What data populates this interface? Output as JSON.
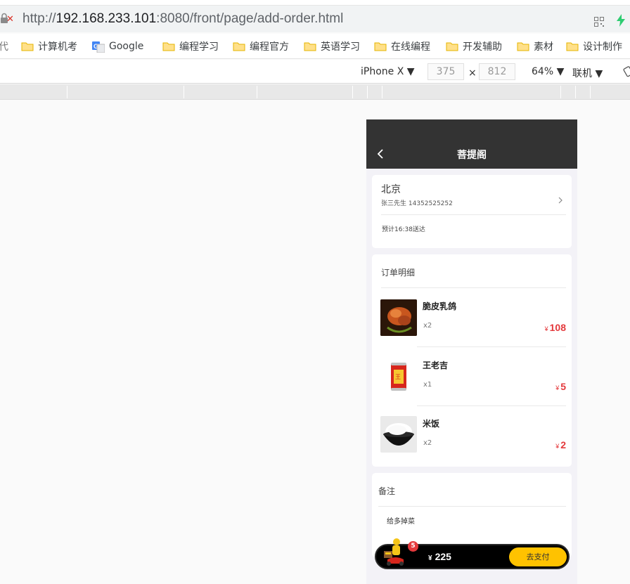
{
  "browser": {
    "url_scheme": "http://",
    "url_host": "192.168.233.101",
    "url_rest": ":8080/front/page/add-order.html",
    "bookmarks": [
      {
        "label": "代",
        "faded": true
      },
      {
        "label": "计算机考",
        "faded": false
      },
      {
        "label": "Google",
        "faded": false
      },
      {
        "label": "编程学习",
        "faded": false
      },
      {
        "label": "编程官方",
        "faded": false
      },
      {
        "label": "英语学习",
        "faded": false
      },
      {
        "label": "在线编程",
        "faded": false
      },
      {
        "label": "开发辅助",
        "faded": false
      },
      {
        "label": "素材",
        "faded": false
      },
      {
        "label": "设计制作",
        "faded": false
      }
    ]
  },
  "devtools": {
    "device": "iPhone X",
    "width": "375",
    "times": "×",
    "height": "812",
    "zoom": "64%",
    "network": "联机"
  },
  "app": {
    "shop_name": "菩提阁",
    "address": {
      "city": "北京",
      "contact": "张三先生 14352525252",
      "eta": "预计16:38送达"
    },
    "order": {
      "title": "订单明细",
      "items": [
        {
          "name": "脆皮乳鸽",
          "qty": "x2",
          "price": "108"
        },
        {
          "name": "王老吉",
          "qty": "x1",
          "price": "5"
        },
        {
          "name": "米饭",
          "qty": "x2",
          "price": "2"
        }
      ],
      "currency": "¥"
    },
    "note": {
      "title": "备注",
      "text": "给多掉菜"
    },
    "checkout": {
      "badge": "5",
      "currency": "¥",
      "total": "225",
      "pay_label": "去支付"
    }
  },
  "colors": {
    "header_bg": "#333333",
    "price_red": "#e4393c",
    "pay_yellow": "#ffc200"
  }
}
